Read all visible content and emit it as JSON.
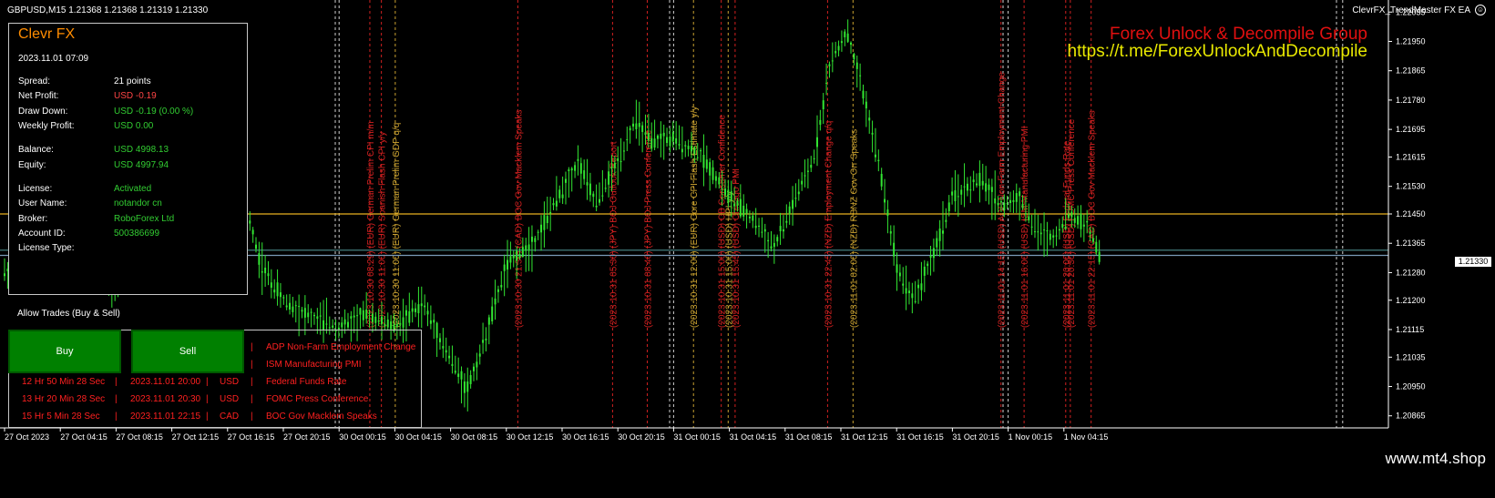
{
  "window": {
    "symbol_title": "GBPUSD,M15  1.21368 1.21368 1.21319 1.21330",
    "ea_title": "ClevrFX_TrendMaster FX EA",
    "promo_line1": "Forex Unlock & Decompile Group",
    "promo_line2": "https://t.me/ForexUnlockAndDecompile",
    "watermark": "www.mt4.shop",
    "current_price_tag": "1.21330"
  },
  "panel": {
    "title": "Clevr FX",
    "datetime": "2023.11.01 07:09",
    "rows": [
      {
        "label": "Spread:",
        "value": "21 points",
        "color": "white"
      },
      {
        "label": "Net Profit:",
        "value": "USD -0.19",
        "color": "red"
      },
      {
        "label": "Draw Down:",
        "value": "USD -0.19 (0.00 %)",
        "color": "green"
      },
      {
        "label": "Weekly Profit:",
        "value": "USD 0.00",
        "color": "green"
      },
      {
        "label": "Balance:",
        "value": "USD 4998.13",
        "color": "green"
      },
      {
        "label": "Equity:",
        "value": "USD 4997.94",
        "color": "green"
      },
      {
        "label": "License:",
        "value": "Activated",
        "color": "green"
      },
      {
        "label": "User Name:",
        "value": "notandor cn",
        "color": "green"
      },
      {
        "label": "Broker:",
        "value": "RoboForex Ltd",
        "color": "green"
      },
      {
        "label": "Account ID:",
        "value": "500386699",
        "color": "green"
      },
      {
        "label": "License Type:",
        "value": "",
        "color": "green"
      }
    ],
    "allow_trades": "Allow Trades (Buy & Sell)",
    "buy_label": "Buy",
    "sell_label": "Sell"
  },
  "news": [
    {
      "countdown": "",
      "datetime": "",
      "currency": "",
      "event": "ADP Non-Farm Employment Change"
    },
    {
      "countdown": "",
      "datetime": "",
      "currency": "",
      "event": "ISM Manufacturing PMI"
    },
    {
      "countdown": "12 Hr 50 Min 28 Sec",
      "datetime": "2023.11.01 20:00",
      "currency": "USD",
      "event": "Federal Funds Rate"
    },
    {
      "countdown": "13 Hr 20 Min 28 Sec",
      "datetime": "2023.11.01 20:30",
      "currency": "USD",
      "event": "FOMC Press Conference"
    },
    {
      "countdown": "15 Hr 5 Min 28 Sec",
      "datetime": "2023.11.01 22:15",
      "currency": "CAD",
      "event": "BOC Gov Macklem Speaks"
    }
  ],
  "news_separator": "|",
  "chart_data": {
    "type": "line",
    "symbol": "GBPUSD",
    "timeframe": "M15",
    "y_ticks": [
      "1.22035",
      "1.21950",
      "1.21865",
      "1.21780",
      "1.21695",
      "1.21615",
      "1.21530",
      "1.21450",
      "1.21365",
      "1.21280",
      "1.21200",
      "1.21115",
      "1.21035",
      "1.20950",
      "1.20865"
    ],
    "ylim": [
      1.2083,
      1.2207
    ],
    "x_ticks": [
      "27 Oct 2023",
      "27 Oct 04:15",
      "27 Oct 08:15",
      "27 Oct 12:15",
      "27 Oct 16:15",
      "27 Oct 20:15",
      "30 Oct 00:15",
      "30 Oct 04:15",
      "30 Oct 08:15",
      "30 Oct 12:15",
      "30 Oct 16:15",
      "30 Oct 20:15",
      "31 Oct 00:15",
      "31 Oct 04:15",
      "31 Oct 08:15",
      "31 Oct 12:15",
      "31 Oct 16:15",
      "31 Oct 20:15",
      "1 Nov 00:15",
      "1 Nov 04:15"
    ],
    "x_range": [
      0,
      20
    ],
    "x_ticks_pos": [
      0,
      1,
      2,
      3,
      4,
      5,
      6,
      7,
      8,
      9,
      10,
      11,
      12,
      13,
      14,
      15,
      16,
      17,
      18,
      19
    ],
    "price_path_x": [
      0,
      0.5,
      1,
      1.5,
      2,
      2.5,
      3,
      3.5,
      4,
      4.3,
      4.6,
      5,
      5.5,
      6,
      6.5,
      7,
      7.5,
      8,
      8.3,
      8.6,
      9,
      9.5,
      10,
      10.3,
      10.6,
      11,
      11.3,
      11.6,
      12,
      12.5,
      13,
      13.5,
      13.8,
      14.2,
      14.5,
      14.8,
      15.1,
      15.4,
      15.7,
      16,
      16.3,
      16.7,
      17,
      17.5,
      17.9,
      18.2,
      18.5,
      18.8,
      19.1,
      19.4,
      19.65
    ],
    "price_path_y": [
      1.2128,
      1.2135,
      1.214,
      1.2131,
      1.2125,
      1.2132,
      1.2128,
      1.2138,
      1.2147,
      1.215,
      1.213,
      1.212,
      1.2115,
      1.2112,
      1.2116,
      1.2112,
      1.2119,
      1.2103,
      1.2094,
      1.2108,
      1.213,
      1.2137,
      1.2152,
      1.216,
      1.2148,
      1.216,
      1.2172,
      1.2166,
      1.2167,
      1.2162,
      1.215,
      1.2142,
      1.2135,
      1.215,
      1.216,
      1.2188,
      1.2198,
      1.218,
      1.2158,
      1.213,
      1.212,
      1.2135,
      1.215,
      1.2155,
      1.2147,
      1.215,
      1.214,
      1.2138,
      1.2145,
      1.2142,
      1.2133
    ],
    "horizontal_lines": [
      {
        "price": 1.2145,
        "color": "#e8b020"
      },
      {
        "price": 1.21345,
        "color": "#4a8a8a"
      },
      {
        "price": 1.2133,
        "color": "#7a9ab8"
      }
    ],
    "news_events": [
      {
        "x": 7.9,
        "label": "(2023.10.30 08:29) (EUR) German Prelim CPI m/m",
        "color": "#d02020"
      },
      {
        "x": 8.15,
        "label": "(2023.10.30 11:00) (EUR) Spanish Flash CPI y/y",
        "color": "#d02020"
      },
      {
        "x": 8.45,
        "label": "(2023.10.30 11:00) (EUR) German Prelim GDP q/q",
        "color": "#c8a030"
      },
      {
        "x": 11.1,
        "label": "(2023.10.30 21:30) (CAD) BOC Gov Macklem Speaks",
        "color": "#d02020"
      },
      {
        "x": 13.15,
        "label": "(2023.10.31 05:30) (JPY) BOJ Outlook Report",
        "color": "#d02020"
      },
      {
        "x": 13.9,
        "label": "(2023.10.31 08:40) (JPY) BOJ Press Conference",
        "color": "#d02020"
      },
      {
        "x": 14.9,
        "label": "(2023.10.31 12:00) (EUR) Core CPI Flash Estimate y/y",
        "color": "#c8a030"
      },
      {
        "x": 15.5,
        "label": "(2023.10.31 15:00) (USD) CB Consumer Confidence",
        "color": "#d02020"
      },
      {
        "x": 15.65,
        "label": "(2023.10.31 15:00) (USD) HPI y/y",
        "color": "#c8a030"
      },
      {
        "x": 15.8,
        "label": "(2023.10.31 15:45) (USD) Chicago PMI",
        "color": "#d02020"
      },
      {
        "x": 17.8,
        "label": "(2023.10.31 22:45) (NZD) Employment Change q/q",
        "color": "#d02020"
      },
      {
        "x": 18.35,
        "label": "(2023.11.01 02:00) (NZD) RBNZ Gov Orr Speaks",
        "color": "#c8a030"
      },
      {
        "x": 21.55,
        "label": "(2023.11.01 14:15) (USD) ADP Non-Farm Employment Change",
        "color": "#d02020"
      },
      {
        "x": 22.05,
        "label": "(2023.11.01 16:00) (USD) ISM Manufacturing PMI",
        "color": "#d02020"
      },
      {
        "x": 22.95,
        "label": "(2023.11.01 20:00) (USD) Federal Funds Rate",
        "color": "#d02020"
      },
      {
        "x": 23.05,
        "label": "(2023.11.01 20:30) (USD) FOMC Press Conference",
        "color": "#d02020"
      },
      {
        "x": 23.5,
        "label": "(2023.11.01 22:15) (CAD) BOC Gov Macklem Speaks",
        "color": "#d02020"
      }
    ],
    "colors": {
      "candles": "#32e632",
      "grid_vertical": "#d0d0d0",
      "axis": "#ffffff"
    }
  }
}
